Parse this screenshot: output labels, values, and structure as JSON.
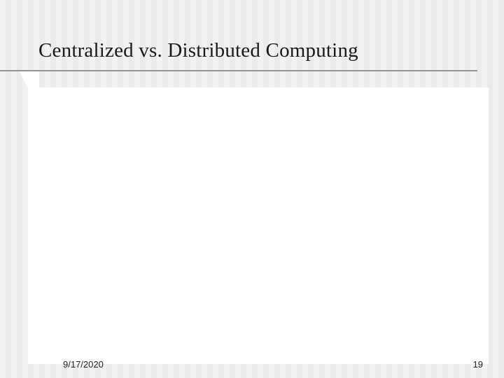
{
  "slide": {
    "title": "Centralized vs. Distributed Computing"
  },
  "footer": {
    "date": "9/17/2020",
    "page_number": "19"
  }
}
